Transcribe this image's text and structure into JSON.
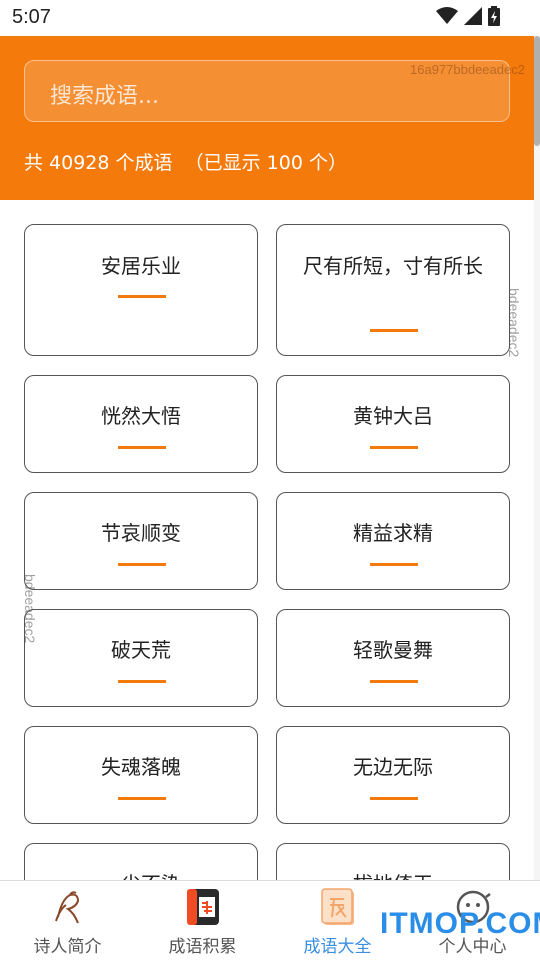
{
  "status_bar": {
    "time": "5:07"
  },
  "header": {
    "search_placeholder": "搜索成语...",
    "count_text": "共 40928 个成语  （已显示 100 个）",
    "watermark": "16a977bbdeeadec2"
  },
  "watermarks": {
    "side": "bdeeadec2"
  },
  "idioms": [
    "安居乐业",
    "尺有所短，寸有所长",
    "恍然大悟",
    "黄钟大吕",
    "节哀顺变",
    "精益求精",
    "破天荒",
    "轻歌曼舞",
    "失魂落魄",
    "无边无际",
    "一尘不染",
    "拔地倚天"
  ],
  "bottom_nav": {
    "items": [
      {
        "label": "诗人简介",
        "icon": "poet-icon"
      },
      {
        "label": "成语积累",
        "icon": "idiom-book-icon"
      },
      {
        "label": "成语大全",
        "icon": "idiom-collection-icon"
      },
      {
        "label": "个人中心",
        "icon": "profile-icon"
      }
    ],
    "active_index": 2,
    "brand": "ITMOP.COM"
  },
  "colors": {
    "accent": "#f47a0c",
    "active_tab": "#3b8fe0"
  }
}
